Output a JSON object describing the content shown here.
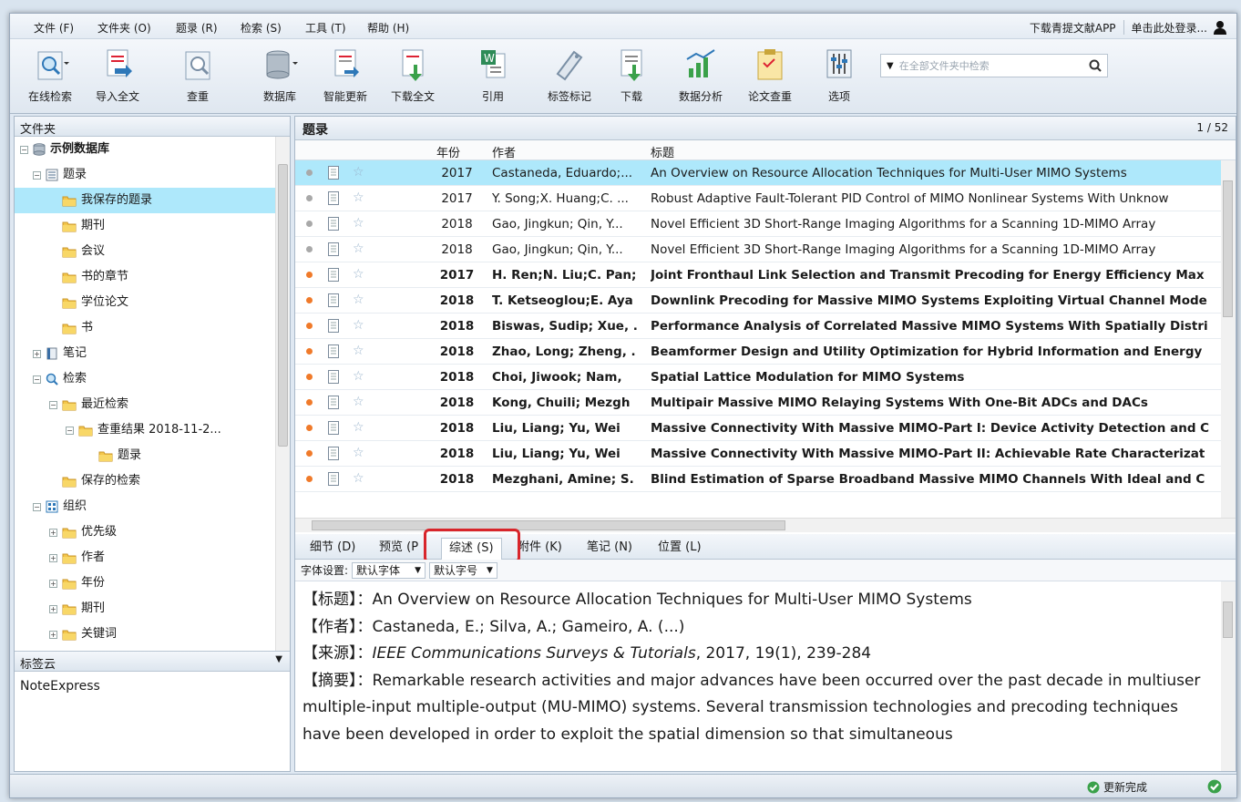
{
  "menu": [
    "文件 (F)",
    "文件夹 (O)",
    "题录 (R)",
    "检索 (S)",
    "工具 (T)",
    "帮助 (H)"
  ],
  "topbar": {
    "download_app": "下载青提文献APP",
    "login": "单击此处登录..."
  },
  "toolbar": {
    "buttons": [
      "在线检索",
      "导入全文",
      "查重",
      "数据库",
      "智能更新",
      "下载全文",
      "引用",
      "标签标记",
      "下载",
      "数据分析",
      "论文查重",
      "选项"
    ],
    "search_placeholder": "在全部文件夹中检索"
  },
  "left": {
    "header": "文件夹",
    "tree": [
      "示例数据库",
      "题录",
      "我保存的题录",
      "期刊",
      "会议",
      "书的章节",
      "学位论文",
      "书",
      "笔记",
      "检索",
      "最近检索",
      "查重结果 2018-11-2...",
      "题录",
      "保存的检索",
      "组织",
      "优先级",
      "作者",
      "年份",
      "期刊",
      "关键词"
    ],
    "tag_header": "标签云",
    "tag_item": "NoteExpress"
  },
  "grid": {
    "title": "题录",
    "page": "1 / 52",
    "columns": {
      "year": "年份",
      "author": "作者",
      "title": "标题"
    },
    "rows": [
      {
        "year": "2017",
        "author": "Castaneda, Eduardo;...",
        "title": "An Overview on Resource Allocation Techniques for Multi-User MIMO Systems",
        "read": true
      },
      {
        "year": "2017",
        "author": "Y. Song;X. Huang;C. ...",
        "title": "Robust Adaptive Fault-Tolerant PID Control of MIMO Nonlinear Systems With Unknow",
        "read": true
      },
      {
        "year": "2018",
        "author": "Gao, Jingkun; Qin, Y...",
        "title": "Novel Efficient 3D Short-Range Imaging Algorithms for a Scanning 1D-MIMO Array",
        "read": true
      },
      {
        "year": "2018",
        "author": "Gao, Jingkun; Qin, Y...",
        "title": "Novel Efficient 3D Short-Range Imaging Algorithms for a Scanning 1D-MIMO Array",
        "read": true
      },
      {
        "year": "2017",
        "author": "H. Ren;N. Liu;C. Pan;",
        "title": "Joint Fronthaul Link Selection and Transmit Precoding for Energy Efficiency Max",
        "read": false
      },
      {
        "year": "2018",
        "author": "T. Ketseoglou;E. Aya",
        "title": "Downlink Precoding for Massive MIMO Systems Exploiting Virtual Channel Mode",
        "read": false
      },
      {
        "year": "2018",
        "author": "Biswas, Sudip; Xue, .",
        "title": "Performance Analysis of Correlated Massive MIMO Systems With Spatially Distri",
        "read": false
      },
      {
        "year": "2018",
        "author": "Zhao, Long; Zheng, .",
        "title": "Beamformer Design and Utility Optimization for Hybrid Information and Energy",
        "read": false
      },
      {
        "year": "2018",
        "author": "Choi, Jiwook; Nam,",
        "title": "Spatial Lattice Modulation for MIMO Systems",
        "read": false
      },
      {
        "year": "2018",
        "author": "Kong, Chuili; Mezgh",
        "title": "Multipair Massive MIMO Relaying Systems With One-Bit ADCs and DACs",
        "read": false
      },
      {
        "year": "2018",
        "author": "Liu, Liang; Yu, Wei",
        "title": "Massive Connectivity With Massive MIMO-Part I: Device Activity Detection and C",
        "read": false
      },
      {
        "year": "2018",
        "author": "Liu, Liang; Yu, Wei",
        "title": "Massive Connectivity With Massive MIMO-Part II: Achievable Rate Characterizat",
        "read": false
      },
      {
        "year": "2018",
        "author": "Mezghani, Amine; S.",
        "title": "Blind Estimation of Sparse Broadband Massive MIMO Channels With Ideal and C",
        "read": false
      }
    ]
  },
  "tabs": [
    "细节 (D)",
    "预览 (P",
    "综述 (S)",
    "附件 (K)",
    "笔记 (N)",
    "位置 (L)"
  ],
  "fontbar": {
    "label": "字体设置:",
    "font": "默认字体",
    "size": "默认字号"
  },
  "detail": {
    "title_label": "【标题】",
    "title": "：An Overview on Resource Allocation Techniques for Multi-User MIMO Systems",
    "author_label": "【作者】",
    "author": "：Castaneda, E.; Silva, A.; Gameiro, A. (...)",
    "source_label": "【来源】",
    "source_sep": "：",
    "source_journal": "IEEE Communications Surveys & Tutorials",
    "source_rest": ", 2017, 19(1), 239-284",
    "abstract_label": "【摘要】",
    "abstract": "：Remarkable research activities and major advances have been occurred over the past decade in multiuser multiple-input multiple-output (MU-MIMO) systems. Several transmission technologies and precoding techniques have been developed in order to exploit the spatial dimension so that simultaneous"
  },
  "status": {
    "text": "更新完成"
  },
  "colors": {
    "accent": "#aee8fb",
    "highlight": "#d8252b",
    "unread_dot": "#f07a2a",
    "read_dot": "#a9a9a9"
  }
}
